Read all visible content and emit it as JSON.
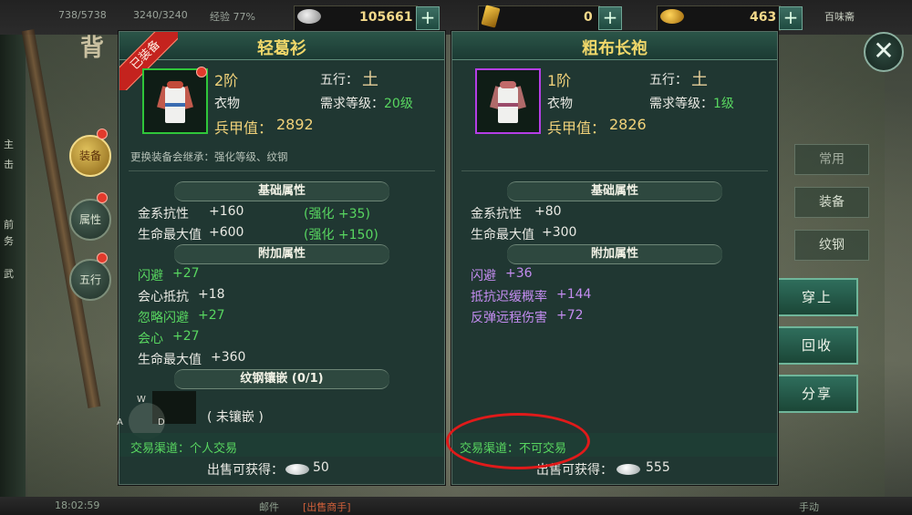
{
  "top_bar": {
    "hp": "738/5738",
    "mp": "3240/3240",
    "exp": "经验 77%",
    "silver": "105661",
    "gold": "0",
    "ingot": "463",
    "plus": "+",
    "right_tag": "百味斋"
  },
  "left_panel": {
    "title_char": "背",
    "tabs": [
      "装备",
      "属性",
      "五行"
    ],
    "side_texts": [
      "主",
      "击",
      "前",
      "务",
      "武"
    ]
  },
  "right_panel": {
    "tabs": [
      "常用",
      "装备",
      "纹钢"
    ],
    "actions": [
      "穿上",
      "回收",
      "分享"
    ],
    "close": "✕"
  },
  "card_left": {
    "title": "轻葛衫",
    "ribbon": "已装备",
    "rank": "2阶",
    "element_label": "五行：",
    "element_glyph": "土",
    "type": "衣物",
    "req_label": "需求等级：",
    "req_value": "20级",
    "armor_label": "兵甲值：",
    "armor_value": "2892",
    "inherit_note": "更换装备会继承：强化等级、纹钢",
    "base_title": "基础属性",
    "base": [
      {
        "name": "金系抗性",
        "value": "+160",
        "bonus": "(强化 +35)"
      },
      {
        "name": "生命最大值",
        "value": "+600",
        "bonus": "(强化 +150)"
      }
    ],
    "extra_title": "附加属性",
    "extra": [
      {
        "name": "闪避",
        "value": "+27",
        "color": "green"
      },
      {
        "name": "会心抵抗",
        "value": "+18",
        "color": "white"
      },
      {
        "name": "忽略闪避",
        "value": "+27",
        "color": "green"
      },
      {
        "name": "会心",
        "value": "+27",
        "color": "green"
      },
      {
        "name": "生命最大值",
        "value": "+360",
        "color": "white"
      }
    ],
    "socket_title": "纹钢镶嵌 (0/1)",
    "socket_status": "( 未镶嵌 )",
    "joystick": {
      "w": "W",
      "a": "A",
      "d": "D"
    },
    "trade": "交易渠道：个人交易",
    "sell_label": "出售可获得：",
    "sell_value": "50"
  },
  "card_right": {
    "title": "粗布长袍",
    "rank": "1阶",
    "element_label": "五行：",
    "element_glyph": "土",
    "type": "衣物",
    "req_label": "需求等级：",
    "req_value": "1级",
    "armor_label": "兵甲值：",
    "armor_value": "2826",
    "base_title": "基础属性",
    "base": [
      {
        "name": "金系抗性",
        "value": "+80"
      },
      {
        "name": "生命最大值",
        "value": "+300"
      }
    ],
    "extra_title": "附加属性",
    "extra": [
      {
        "name": "闪避",
        "value": "+36",
        "color": "purple"
      },
      {
        "name": "抵抗迟缓概率",
        "value": "+144",
        "color": "purple"
      },
      {
        "name": "反弹远程伤害",
        "value": "+72",
        "color": "purple"
      }
    ],
    "trade": "交易渠道：不可交易",
    "sell_label": "出售可获得：",
    "sell_value": "555"
  },
  "bottom_bar": {
    "time": "18:02:59",
    "mid1": "邮件",
    "mid2": "[出售商手]",
    "right": "手动"
  },
  "colors": {
    "quality_green": "#2fc63a",
    "quality_purple": "#b43ee6",
    "title_gold": "#f1d86a",
    "highlight_red": "#e01a1a"
  }
}
